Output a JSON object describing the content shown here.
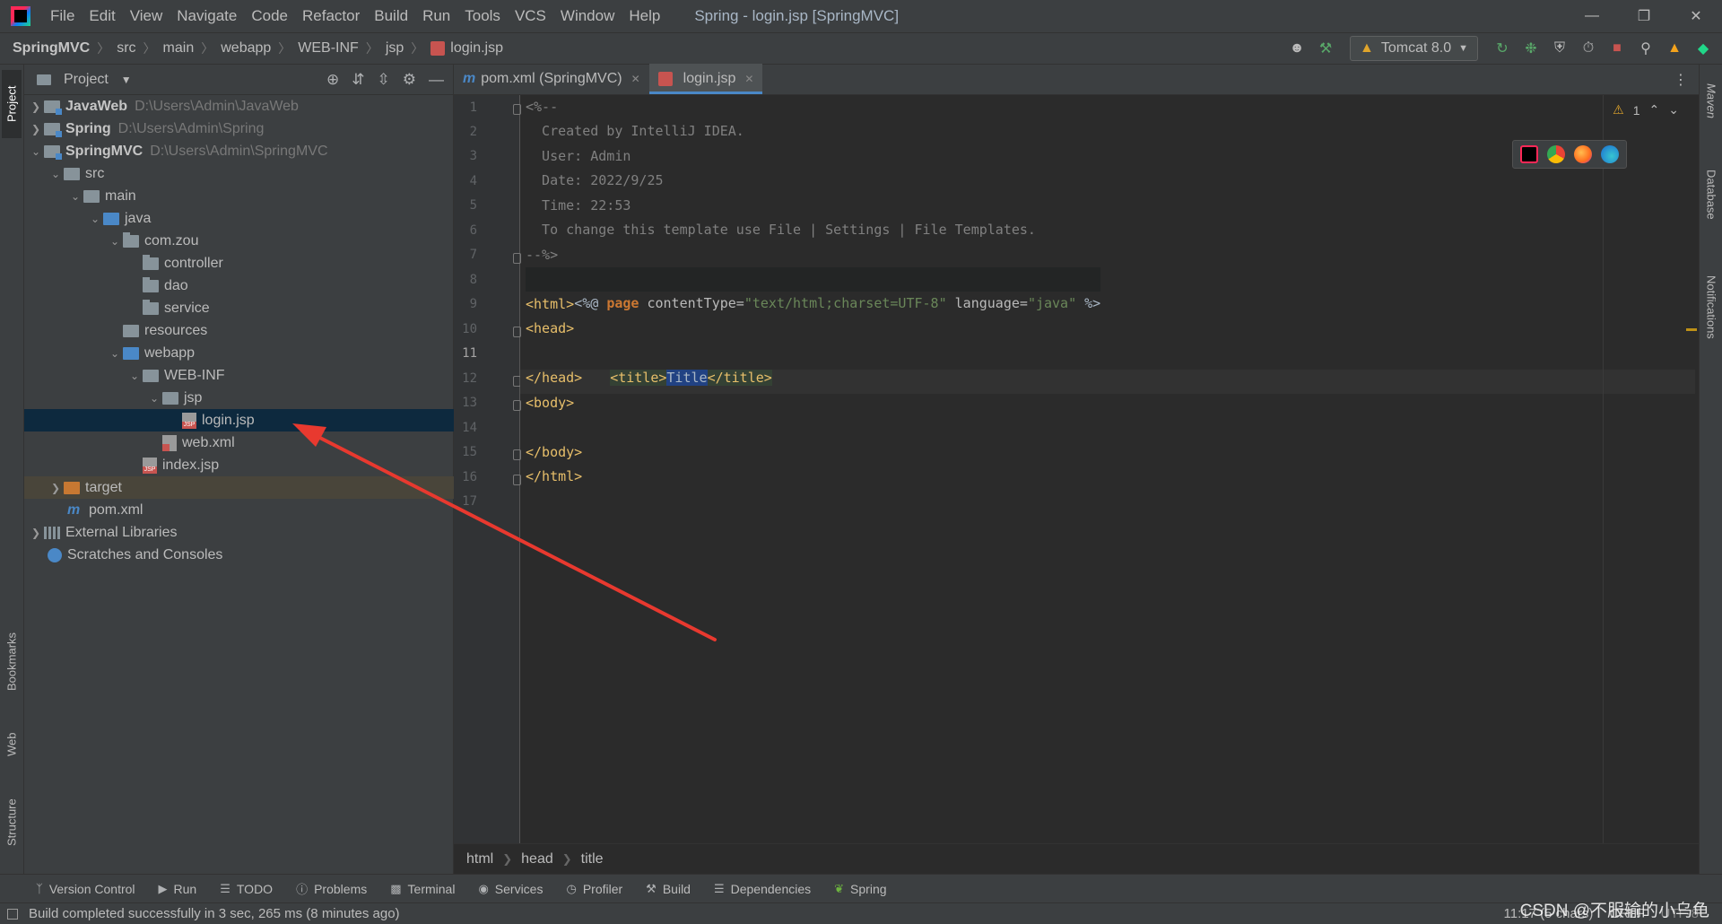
{
  "menu": {
    "items": [
      "File",
      "Edit",
      "View",
      "Navigate",
      "Code",
      "Refactor",
      "Build",
      "Run",
      "Tools",
      "VCS",
      "Window",
      "Help"
    ],
    "window_title": "Spring - login.jsp [SpringMVC]"
  },
  "navbar": {
    "crumbs": [
      "SpringMVC",
      "src",
      "main",
      "webapp",
      "WEB-INF",
      "jsp",
      "login.jsp"
    ],
    "run_config": "Tomcat 8.0"
  },
  "project": {
    "title": "Project",
    "tree": [
      {
        "label": "JavaWeb",
        "path": "D:\\Users\\Admin\\JavaWeb"
      },
      {
        "label": "Spring",
        "path": "D:\\Users\\Admin\\Spring"
      },
      {
        "label": "SpringMVC",
        "path": "D:\\Users\\Admin\\SpringMVC"
      },
      {
        "label": "src"
      },
      {
        "label": "main"
      },
      {
        "label": "java"
      },
      {
        "label": "com.zou"
      },
      {
        "label": "controller"
      },
      {
        "label": "dao"
      },
      {
        "label": "service"
      },
      {
        "label": "resources"
      },
      {
        "label": "webapp"
      },
      {
        "label": "WEB-INF"
      },
      {
        "label": "jsp"
      },
      {
        "label": "login.jsp"
      },
      {
        "label": "web.xml"
      },
      {
        "label": "index.jsp"
      },
      {
        "label": "target"
      },
      {
        "label": "pom.xml"
      },
      {
        "label": "External Libraries"
      },
      {
        "label": "Scratches and Consoles"
      }
    ]
  },
  "editor": {
    "tabs": [
      {
        "label": "pom.xml (SpringMVC)",
        "icon": "maven-icon"
      },
      {
        "label": "login.jsp",
        "icon": "jsp-file-icon"
      }
    ],
    "line_numbers": [
      "1",
      "2",
      "3",
      "4",
      "5",
      "6",
      "7",
      "8",
      "9",
      "10",
      "11",
      "12",
      "13",
      "14",
      "15",
      "16",
      "17"
    ],
    "current_line": 11,
    "lines": {
      "l1": "<%--",
      "l2": "  Created by IntelliJ IDEA.",
      "l3": "  User: Admin",
      "l4": "  Date: 2022/9/25",
      "l5": "  Time: 22:53",
      "l6": "  To change this template use File | Settings | File Templates.",
      "l7": "--%>",
      "l8_open": "<%@ ",
      "l8_kw": "page",
      "l8_attr1": " contentType=",
      "l8_val1": "\"text/html;charset=UTF-8\"",
      "l8_attr2": " language=",
      "l8_val2": "\"java\"",
      "l8_close": " %>",
      "l9": "<html>",
      "l10": "<head>",
      "l11_open": "<title>",
      "l11_text": "Title",
      "l11_close": "</title>",
      "l12": "</head>",
      "l13": "<body>",
      "l15": "</body>",
      "l16": "</html>"
    },
    "warnings_count": "1",
    "breadcrumb": [
      "html",
      "head",
      "title"
    ]
  },
  "left_stripe": {
    "project": "Project",
    "bookmarks": "Bookmarks",
    "web": "Web",
    "structure": "Structure"
  },
  "right_stripe": {
    "maven": "Maven",
    "database": "Database",
    "notifications": "Notifications"
  },
  "bottom_tools": [
    "Version Control",
    "Run",
    "TODO",
    "Problems",
    "Terminal",
    "Services",
    "Profiler",
    "Build",
    "Dependencies",
    "Spring"
  ],
  "status": {
    "message": "Build completed successfully in 3 sec, 265 ms (8 minutes ago)",
    "position": "11:17 (5 chars)",
    "line_sep": "CRLF",
    "encoding": "UTF-8"
  },
  "watermark": "CSDN @不服输的小乌龟",
  "colors": {
    "accent": "#4a88c7",
    "arrow": "#e8392f",
    "selection": "#0d293e"
  }
}
